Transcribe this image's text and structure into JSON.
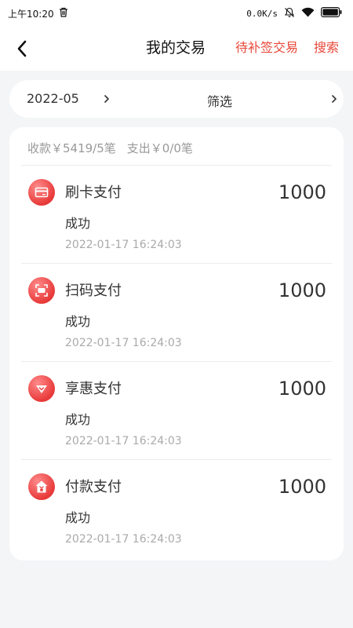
{
  "status_bar": {
    "time": "上午10:20",
    "speed": "0.0K/s",
    "icons": [
      "trash-icon",
      "mute-icon",
      "wifi-icon",
      "battery-icon"
    ]
  },
  "nav": {
    "title": "我的交易",
    "pending_link": "待补签交易",
    "search_link": "搜索",
    "accent_color": "#e8493a"
  },
  "filter": {
    "month": "2022-05",
    "filter_label": "筛选"
  },
  "summary": {
    "income": "收款￥5419/5笔",
    "expense": "支出￥0/0笔"
  },
  "transactions": [
    {
      "icon": "card-pay-icon",
      "name": "刷卡支付",
      "amount": "1000",
      "status": "成功",
      "time": "2022-01-17 16:24:03"
    },
    {
      "icon": "scan-pay-icon",
      "name": "扫码支付",
      "amount": "1000",
      "status": "成功",
      "time": "2022-01-17 16:24:03"
    },
    {
      "icon": "discount-pay-icon",
      "name": "享惠支付",
      "amount": "1000",
      "status": "成功",
      "time": "2022-01-17 16:24:03"
    },
    {
      "icon": "payment-pay-icon",
      "name": "付款支付",
      "amount": "1000",
      "status": "成功",
      "time": "2022-01-17 16:24:03"
    }
  ]
}
